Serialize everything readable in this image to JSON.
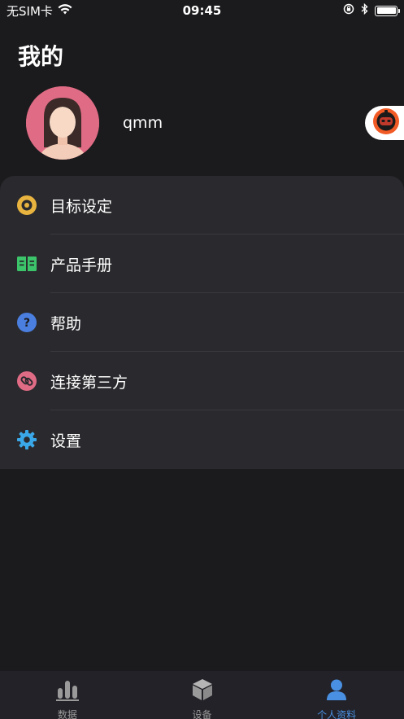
{
  "status_bar": {
    "carrier": "无SIM卡",
    "time": "09:45"
  },
  "page": {
    "title": "我的"
  },
  "profile": {
    "username": "qmm",
    "avatar_color": "#e06b85"
  },
  "menu": {
    "items": [
      {
        "label": "目标设定",
        "icon": "target-icon",
        "color": "#e8b33e"
      },
      {
        "label": "产品手册",
        "icon": "book-icon",
        "color": "#3cc46b"
      },
      {
        "label": "帮助",
        "icon": "help-icon",
        "color": "#4a7fe0"
      },
      {
        "label": "连接第三方",
        "icon": "link-icon",
        "color": "#e06b85"
      },
      {
        "label": "设置",
        "icon": "gear-icon",
        "color": "#3aa8e8"
      }
    ]
  },
  "tab_bar": {
    "tabs": [
      {
        "label": "数据",
        "icon": "bar-chart-icon"
      },
      {
        "label": "设备",
        "icon": "cube-icon"
      },
      {
        "label": "个人资料",
        "icon": "person-icon"
      }
    ],
    "active_index": 2,
    "active_color": "#4a90e2"
  }
}
